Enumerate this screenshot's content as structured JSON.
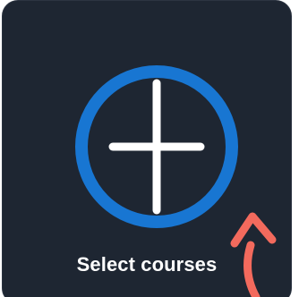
{
  "card": {
    "label": "Select courses",
    "icon": "plus-circle-icon",
    "background_color": "#1e2632",
    "ring_color": "#1876d2",
    "plus_color": "#ffffff"
  },
  "annotation": {
    "icon": "pointer-arrow-icon",
    "color": "#f36a5d"
  }
}
